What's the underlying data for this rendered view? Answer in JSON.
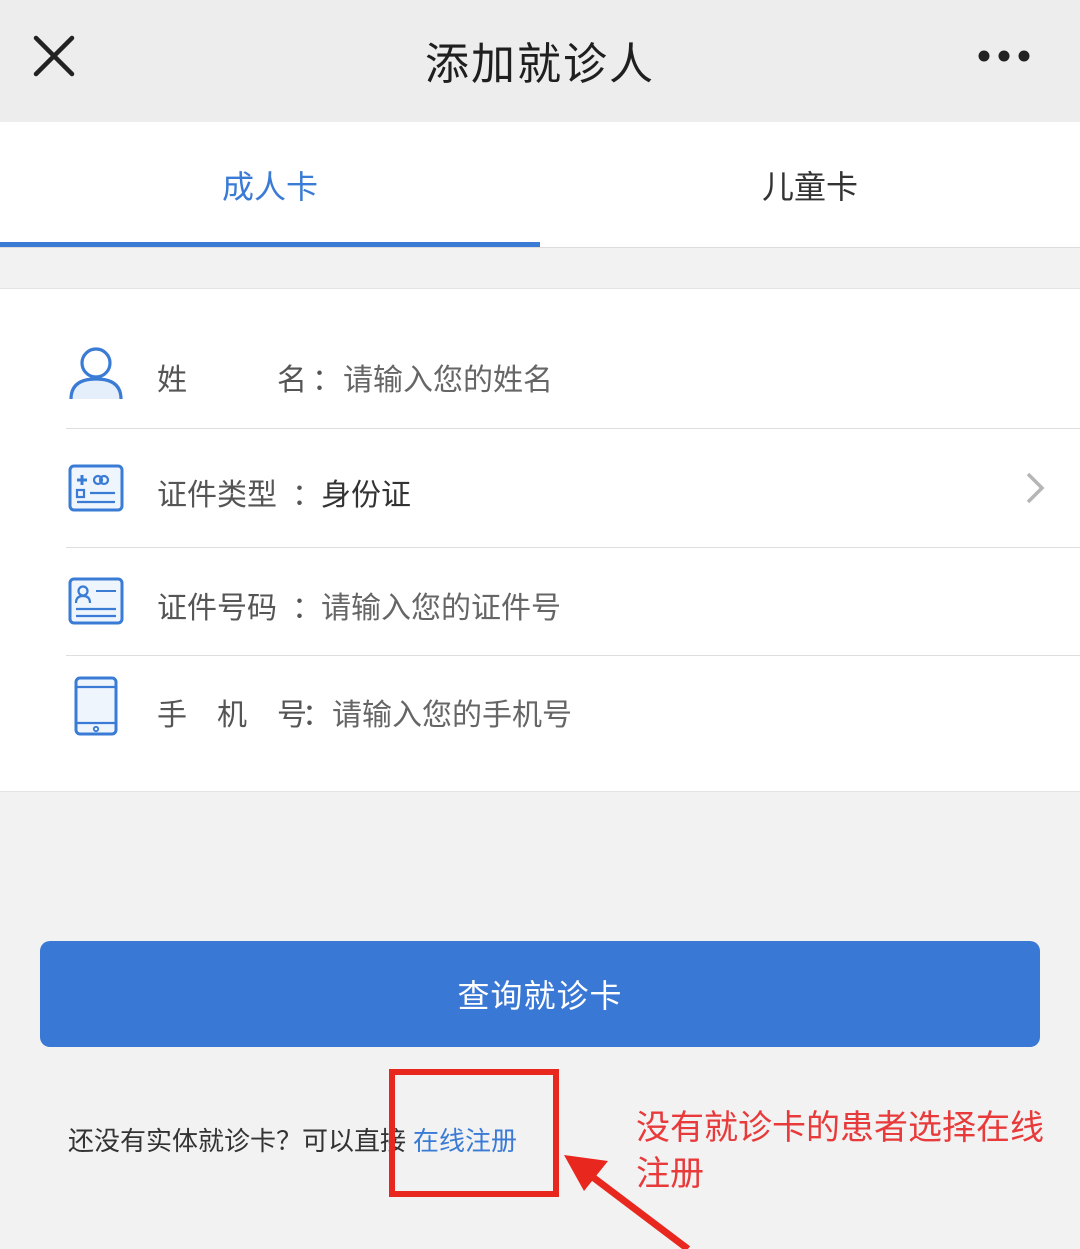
{
  "header": {
    "title": "添加就诊人",
    "close_icon": "close-icon",
    "more_icon": "more-dots-icon"
  },
  "tabs": [
    {
      "label": "成人卡",
      "active": true
    },
    {
      "label": "儿童卡",
      "active": false
    }
  ],
  "form": {
    "rows": [
      {
        "icon": "user-icon",
        "label": "姓　　　名",
        "colon": "：",
        "placeholder": "请输入您的姓名"
      },
      {
        "icon": "id-card-type-icon",
        "label": "证件类型",
        "colon": "：",
        "value": "身份证"
      },
      {
        "icon": "id-number-icon",
        "label": "证件号码",
        "colon": "：",
        "placeholder": "请输入您的证件号"
      },
      {
        "icon": "phone-icon",
        "label": "手　机　号",
        "colon": "：",
        "placeholder": "请输入您的手机号"
      }
    ]
  },
  "query_button": "查询就诊卡",
  "bottom": {
    "prompt": "还没有实体就诊卡？可以直接",
    "link": "在线注册"
  },
  "annotation": "没有就诊卡的患者选择在线注册",
  "colors": {
    "accent": "#3a7bd5",
    "button": "#3a78d6",
    "annotation": "#e8281e"
  }
}
